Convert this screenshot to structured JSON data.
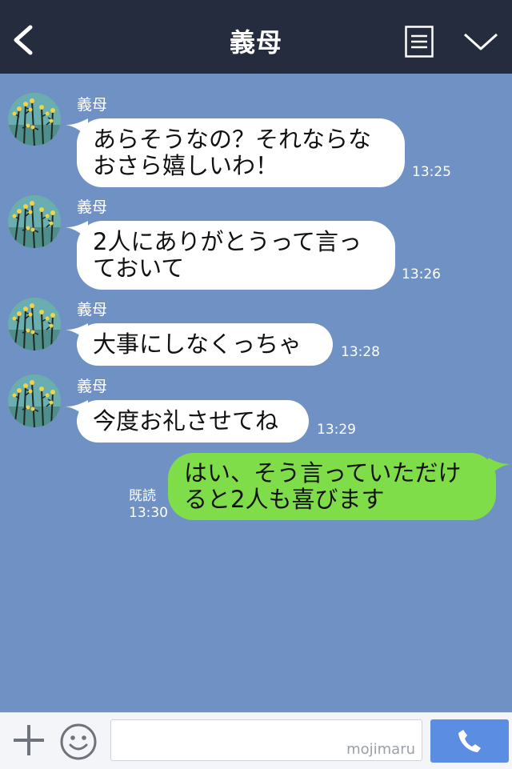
{
  "header": {
    "title": "義母",
    "icons": [
      "back-chevron-icon",
      "menu-list-icon",
      "chevron-down-icon"
    ]
  },
  "messages": [
    {
      "direction": "in",
      "sender": "義母",
      "lines": [
        "あらそうなの？それならな",
        "おさら嬉しいわ！"
      ],
      "time": "13:25"
    },
    {
      "direction": "in",
      "sender": "義母",
      "lines": [
        "2人にありがとうって言っ",
        "ておいて"
      ],
      "time": "13:26"
    },
    {
      "direction": "in",
      "sender": "義母",
      "lines": [
        "大事にしなくっちゃ"
      ],
      "time": "13:28"
    },
    {
      "direction": "in",
      "sender": "義母",
      "lines": [
        "今度お礼させてね"
      ],
      "time": "13:29"
    },
    {
      "direction": "out",
      "read_label": "既読",
      "lines": [
        "はい、そう言っていただけ",
        "ると2人も喜びます"
      ],
      "time": "13:30"
    }
  ],
  "input_bar": {
    "icons": [
      "plus-icon",
      "smiley-icon",
      "phone-icon"
    ],
    "watermark": "mojimaru",
    "colors": {
      "call_button": "#5b8ee3"
    }
  },
  "colors": {
    "header_bg": "#252c3d",
    "chat_bg": "#7091c3",
    "incoming_bubble": "#ffffff",
    "outgoing_bubble": "#7fdd4a"
  }
}
